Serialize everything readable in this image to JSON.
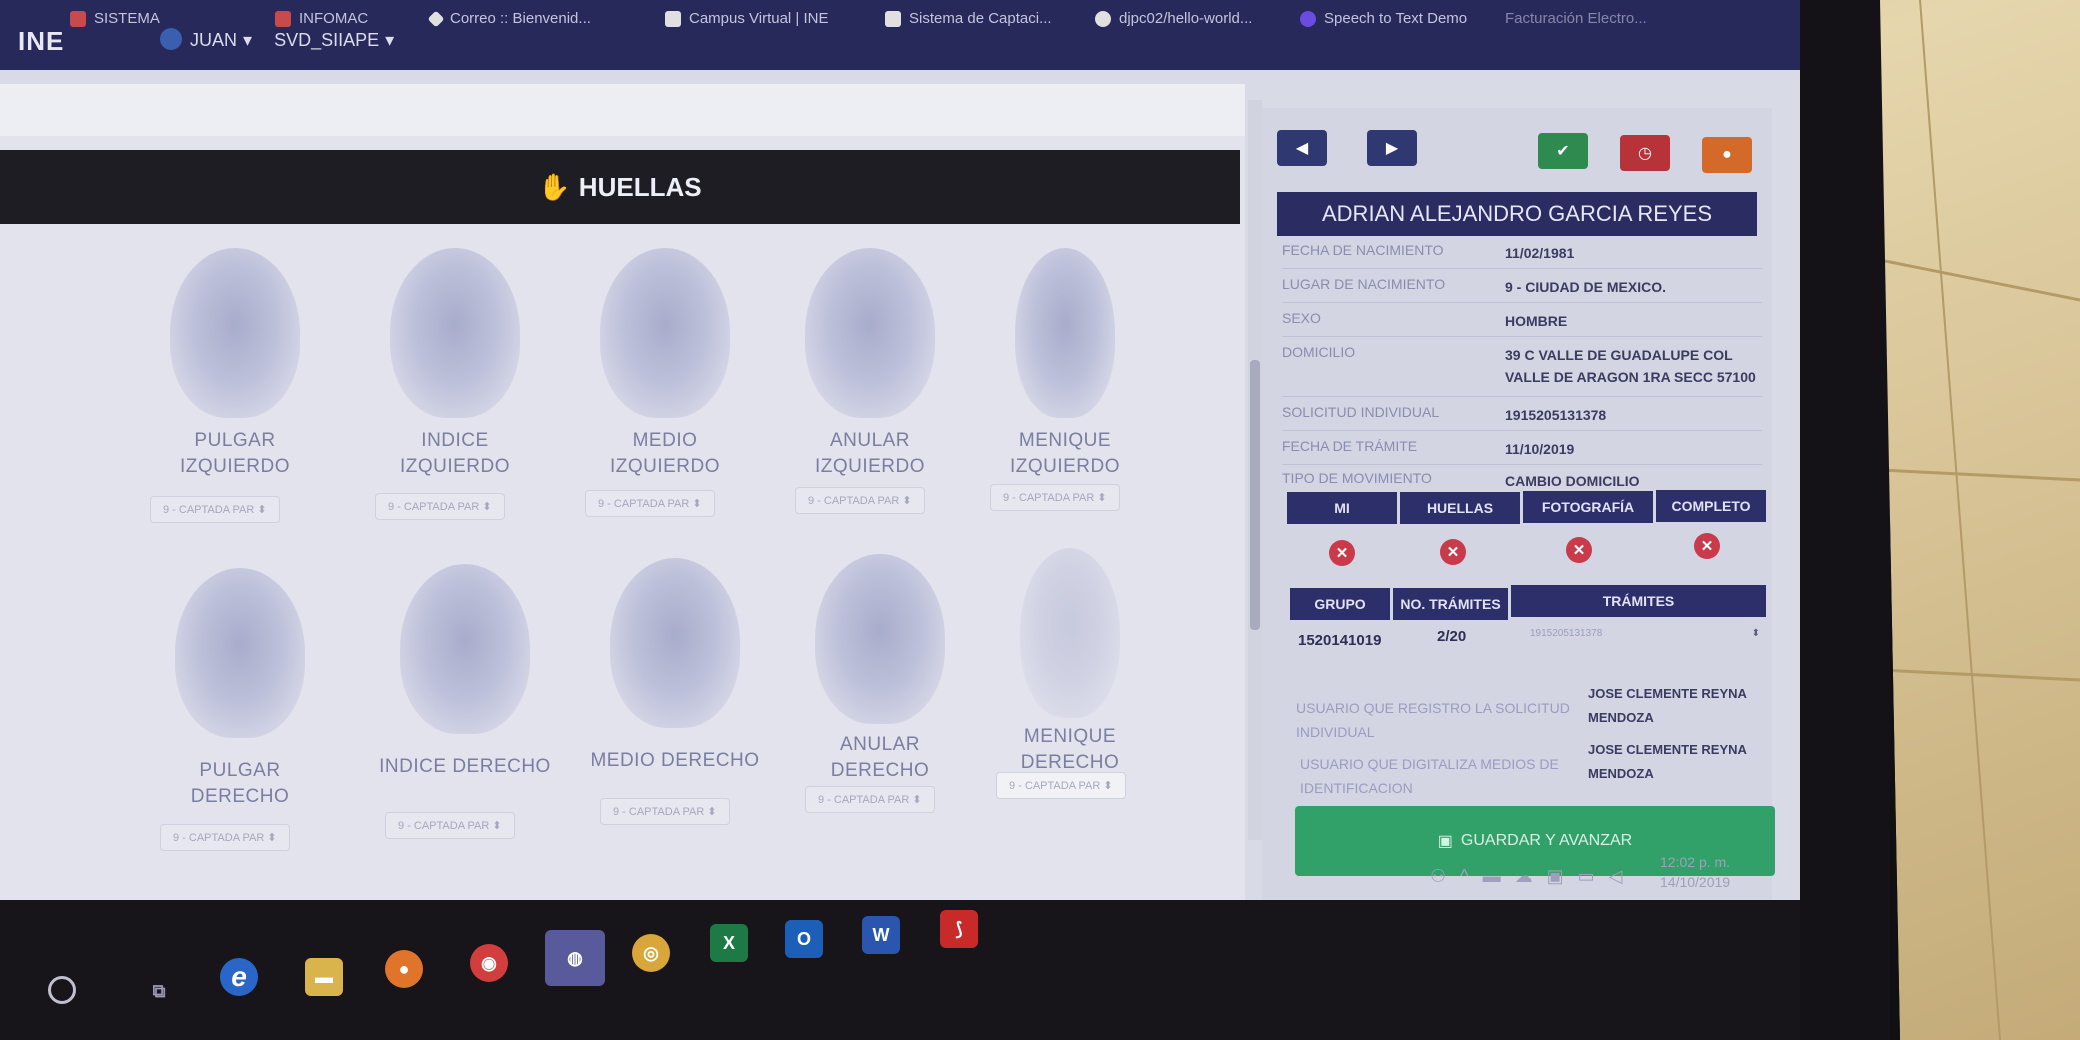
{
  "bookmarks": [
    {
      "label": "SISTEMA",
      "color": "#c94a4a"
    },
    {
      "label": "INFOMAC",
      "color": "#c94a4a"
    },
    {
      "label": "Correo :: Bienvenid...",
      "color": "#e0e0e0"
    },
    {
      "label": "Campus Virtual | INE",
      "color": "#e0e0e0"
    },
    {
      "label": "Sistema de Captaci...",
      "color": "#e0e0e0"
    },
    {
      "label": "djpc02/hello-world...",
      "color": "#e0e0e0"
    },
    {
      "label": "Speech to Text Demo",
      "color": "#6a4ce0"
    },
    {
      "label": "Facturación Electro...",
      "color": "#8a8aa6"
    }
  ],
  "header": {
    "logo": "INE",
    "user": "JUAN",
    "system": "SVD_SIIAPE"
  },
  "huellas": {
    "title": "HUELLAS",
    "fingers": [
      {
        "label": "PULGAR IZQUIERDO",
        "status": "9 - CAPTADA PAR"
      },
      {
        "label": "INDICE IZQUIERDO",
        "status": "9 - CAPTADA PAR"
      },
      {
        "label": "MEDIO IZQUIERDO",
        "status": "9 - CAPTADA PAR"
      },
      {
        "label": "ANULAR IZQUIERDO",
        "status": "9 - CAPTADA PAR"
      },
      {
        "label": "MENIQUE IZQUIERDO",
        "status": "9 - CAPTADA PAR"
      },
      {
        "label": "PULGAR DERECHO",
        "status": "9 - CAPTADA PAR"
      },
      {
        "label": "INDICE DERECHO",
        "status": "9 - CAPTADA PAR"
      },
      {
        "label": "MEDIO DERECHO",
        "status": "9 - CAPTADA PAR"
      },
      {
        "label": "ANULAR DERECHO",
        "status": "9 - CAPTADA PAR"
      },
      {
        "label": "MENIQUE DERECHO",
        "status": "9 - CAPTADA PAR"
      }
    ]
  },
  "person": {
    "name": "ADRIAN ALEJANDRO GARCIA REYES",
    "fields": [
      {
        "label": "FECHA DE NACIMIENTO",
        "value": "11/02/1981"
      },
      {
        "label": "LUGAR DE NACIMIENTO",
        "value": "9 - CIUDAD DE MEXICO."
      },
      {
        "label": "SEXO",
        "value": "HOMBRE"
      },
      {
        "label": "DOMICILIO",
        "value": "39 C VALLE DE GUADALUPE COL VALLE DE ARAGON 1RA SECC 57100"
      },
      {
        "label": "SOLICITUD INDIVIDUAL",
        "value": "1915205131378"
      },
      {
        "label": "FECHA DE TRÁMITE",
        "value": "11/10/2019"
      },
      {
        "label": "TIPO DE MOVIMIENTO",
        "value": "CAMBIO DOMICILIO"
      }
    ]
  },
  "status_table": {
    "headers": [
      "MI",
      "HUELLAS",
      "FOTOGRAFÍA",
      "COMPLETO"
    ]
  },
  "group_table": {
    "headers": [
      "GRUPO",
      "NO. TRÁMITES",
      "TRÁMITES"
    ],
    "grupo": "1520141019",
    "no_tramites": "2/20",
    "tramites": "1915205131378"
  },
  "users": [
    {
      "label": "USUARIO QUE REGISTRO LA SOLICITUD INDIVIDUAL",
      "value": "JOSE CLEMENTE REYNA MENDOZA"
    },
    {
      "label": "USUARIO QUE DIGITALIZA MEDIOS DE IDENTIFICACION",
      "value": "JOSE CLEMENTE REYNA MENDOZA"
    }
  ],
  "save_button": "GUARDAR Y AVANZAR",
  "clock": {
    "time": "12:02 p. m.",
    "date": "14/10/2019"
  },
  "taskbar_icons": [
    "start-button",
    "task-view",
    "edge",
    "file-explorer",
    "firefox",
    "app-red",
    "app-active",
    "chrome",
    "excel",
    "outlook",
    "word",
    "acrobat"
  ]
}
